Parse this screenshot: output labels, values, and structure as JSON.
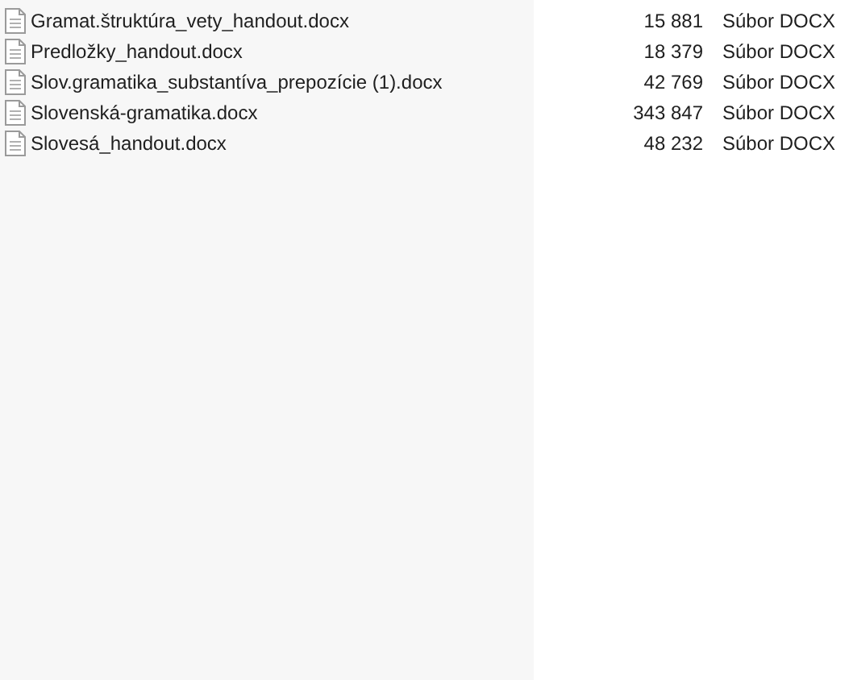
{
  "files": [
    {
      "name": "Gramat.štruktúra_vety_handout.docx",
      "size": "15 881",
      "type": "Súbor DOCX"
    },
    {
      "name": "Predložky_handout.docx",
      "size": "18 379",
      "type": "Súbor DOCX"
    },
    {
      "name": "Slov.gramatika_substantíva_prepozície (1).docx",
      "size": "42 769",
      "type": "Súbor DOCX"
    },
    {
      "name": "Slovenská-gramatika.docx",
      "size": "343 847",
      "type": "Súbor DOCX"
    },
    {
      "name": "Slovesá_handout.docx",
      "size": "48 232",
      "type": "Súbor DOCX"
    }
  ]
}
